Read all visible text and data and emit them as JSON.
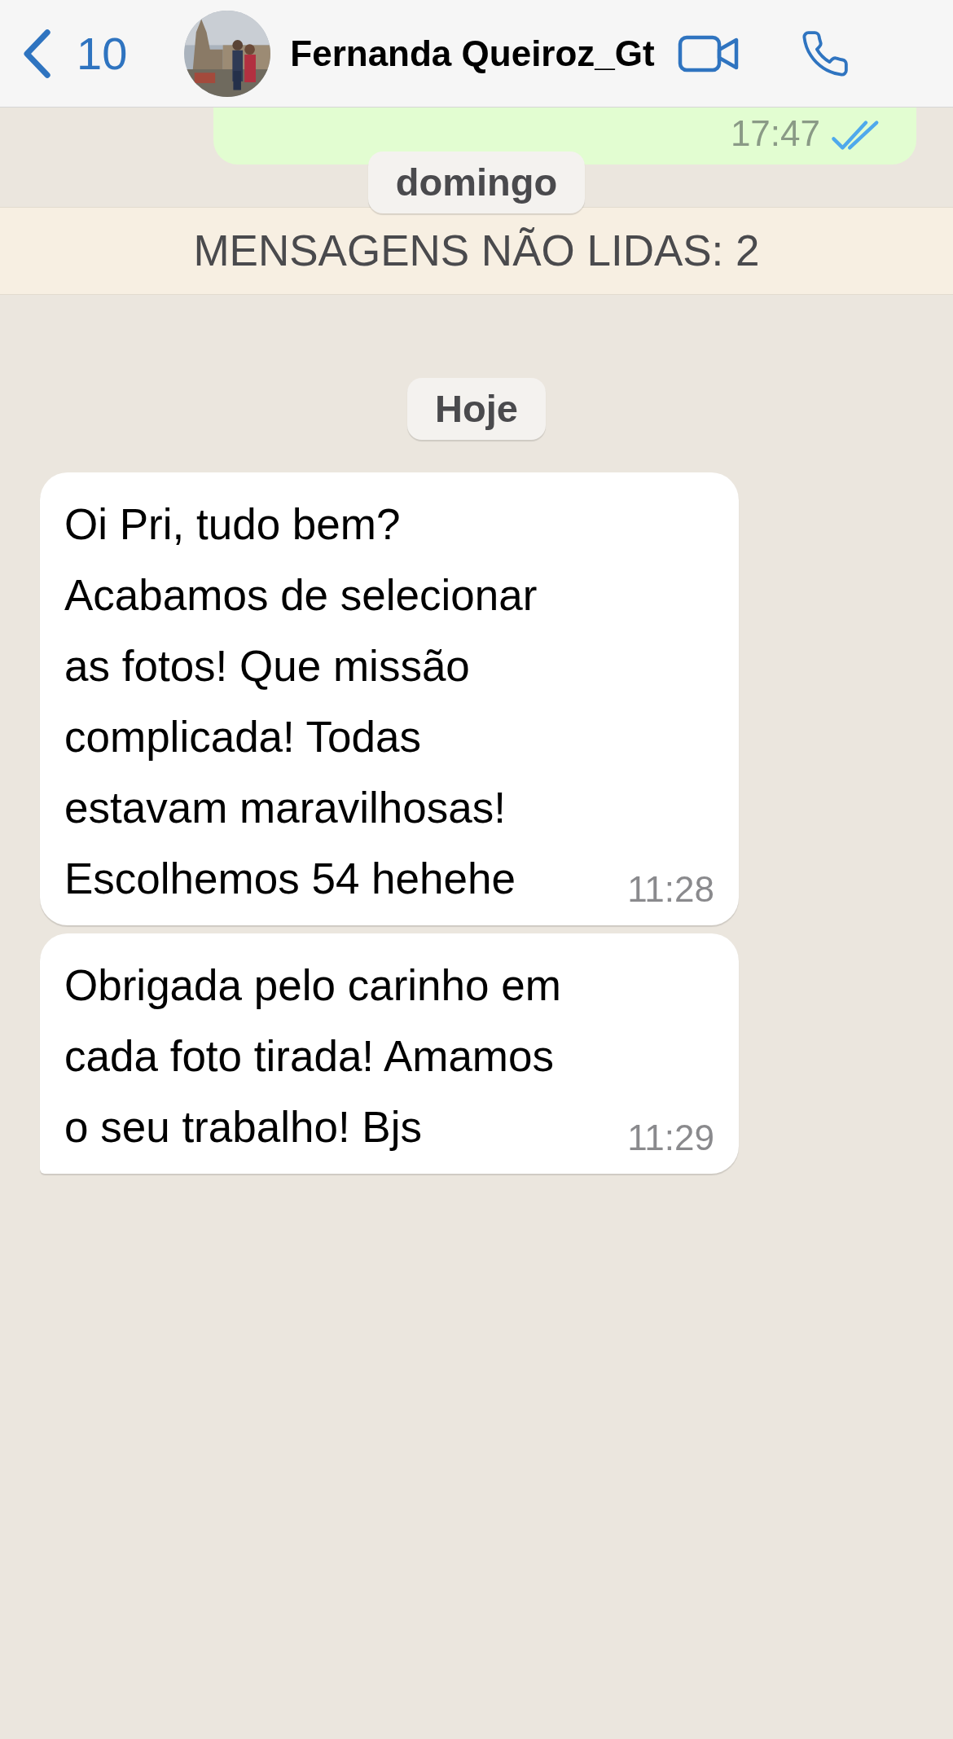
{
  "header": {
    "back_count": "10",
    "contact_name": "Fernanda Queiroz_Gt"
  },
  "messages": [
    {
      "kind": "outgoing",
      "time": "17:47",
      "read": true
    },
    {
      "kind": "date",
      "text": "domingo"
    },
    {
      "kind": "unread",
      "text": "MENSAGENS NÃO LIDAS: 2"
    },
    {
      "kind": "date",
      "text": "Hoje"
    },
    {
      "kind": "incoming",
      "lines": [
        "Oi Pri, tudo bem?",
        "Acabamos de selecionar",
        "as fotos! Que missão",
        "complicada! Todas",
        "estavam maravilhosas!",
        "Escolhemos 54 hehehe"
      ],
      "time": "11:28",
      "tail": false
    },
    {
      "kind": "incoming",
      "lines": [
        "Obrigada pelo carinho em",
        "cada foto tirada! Amamos",
        "o seu trabalho! Bjs"
      ],
      "time": "11:29",
      "tail": true
    }
  ]
}
